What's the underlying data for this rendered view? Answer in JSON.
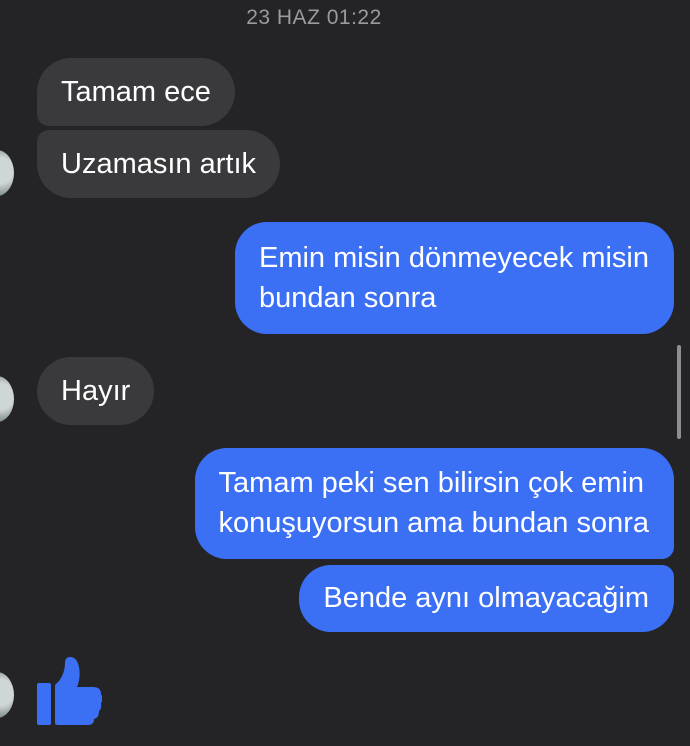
{
  "conversation": {
    "timestamp": "23 HAZ 01:22",
    "messages": [
      {
        "direction": "incoming",
        "lines": [
          "Tamam ece"
        ]
      },
      {
        "direction": "incoming",
        "lines": [
          "Uzamasın artık"
        ]
      },
      {
        "direction": "outgoing",
        "lines": [
          "Emin misin dönmeyecek misin",
          "bundan sonra"
        ]
      },
      {
        "direction": "incoming",
        "lines": [
          "Hayır"
        ]
      },
      {
        "direction": "outgoing",
        "lines": [
          "Tamam peki sen bilirsin çok emin",
          "konuşuyorsun ama bundan sonra"
        ]
      },
      {
        "direction": "outgoing",
        "lines": [
          "Bende aynı olmayacağim"
        ]
      }
    ],
    "reaction_icon": "thumbs-up-icon"
  },
  "colors": {
    "background": "#242426",
    "incoming_bubble": "#3a3a3d",
    "outgoing_bubble": "#3b6ff4",
    "like_icon": "#3b6ff4",
    "timestamp_text": "#9a9a9f"
  }
}
